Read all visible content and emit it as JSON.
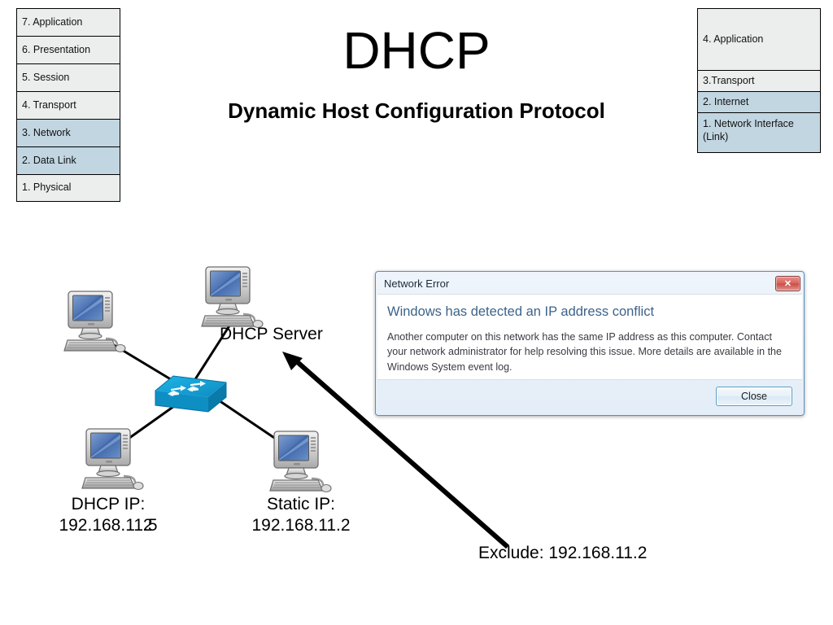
{
  "title": {
    "main": "DHCP",
    "subtitle": "Dynamic Host Configuration Protocol"
  },
  "osi_stack": {
    "name": "OSI model layers",
    "highlight_color": "#c2d6e2",
    "base_color": "#eceded",
    "layers": [
      {
        "label": "7. Application",
        "highlighted": false
      },
      {
        "label": "6. Presentation",
        "highlighted": false
      },
      {
        "label": "5. Session",
        "highlighted": false
      },
      {
        "label": "4. Transport",
        "highlighted": false
      },
      {
        "label": "3. Network",
        "highlighted": true
      },
      {
        "label": "2. Data Link",
        "highlighted": true
      },
      {
        "label": "1. Physical",
        "highlighted": false
      }
    ]
  },
  "tcpip_stack": {
    "name": "TCP/IP model layers",
    "highlight_color": "#c2d6e2",
    "base_color": "#eceded",
    "layers": [
      {
        "label": "4. Application",
        "highlighted": false
      },
      {
        "label": "3.Transport",
        "highlighted": false
      },
      {
        "label": "2. Internet",
        "highlighted": true
      },
      {
        "label": "1. Network Interface (Link)",
        "highlighted": true
      }
    ]
  },
  "diagram": {
    "server_label": "DHCP Server",
    "dhcp_client": {
      "line1": "DHCP IP:",
      "line2_prefix": "192.168.11.",
      "line2_digit": "5",
      "line2_ghost_digit": "2"
    },
    "static_client": {
      "line1": "Static IP:",
      "line2": "192.168.11.2"
    },
    "exclude_label": "Exclude: 192.168.11.2",
    "switch_color": "#12a2db",
    "line_color": "#000000"
  },
  "dialog": {
    "title": "Network Error",
    "close_glyph": "✕",
    "heading": "Windows has detected an IP address conflict",
    "body": "Another computer on this network has the same IP address as this computer. Contact your network administrator for help resolving this issue. More details are available in the Windows System event log.",
    "button_label": "Close",
    "heading_color": "#3c6389"
  }
}
